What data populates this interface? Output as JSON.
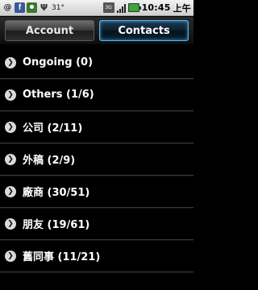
{
  "status_bar": {
    "temperature": "31°",
    "network": "3G",
    "time": "10:45",
    "ampm": "上午",
    "left_icons": [
      "at-icon",
      "facebook-icon",
      "person-icon",
      "usb-icon"
    ],
    "right_icons": [
      "network-3g-icon",
      "signal-icon",
      "battery-icon"
    ]
  },
  "tabs": [
    {
      "label": "Account",
      "active": false
    },
    {
      "label": "Contacts",
      "active": true
    }
  ],
  "groups": [
    {
      "label": "Ongoing (0)"
    },
    {
      "label": "Others (1/6)"
    },
    {
      "label": "公司 (2/11)"
    },
    {
      "label": "外稿 (2/9)"
    },
    {
      "label": "廠商 (30/51)"
    },
    {
      "label": "朋友 (19/61)"
    },
    {
      "label": "舊同事 (11/21)"
    }
  ],
  "colors": {
    "active_tab_border": "#5ab4e8",
    "background": "#000000",
    "battery": "#3aa53a"
  }
}
